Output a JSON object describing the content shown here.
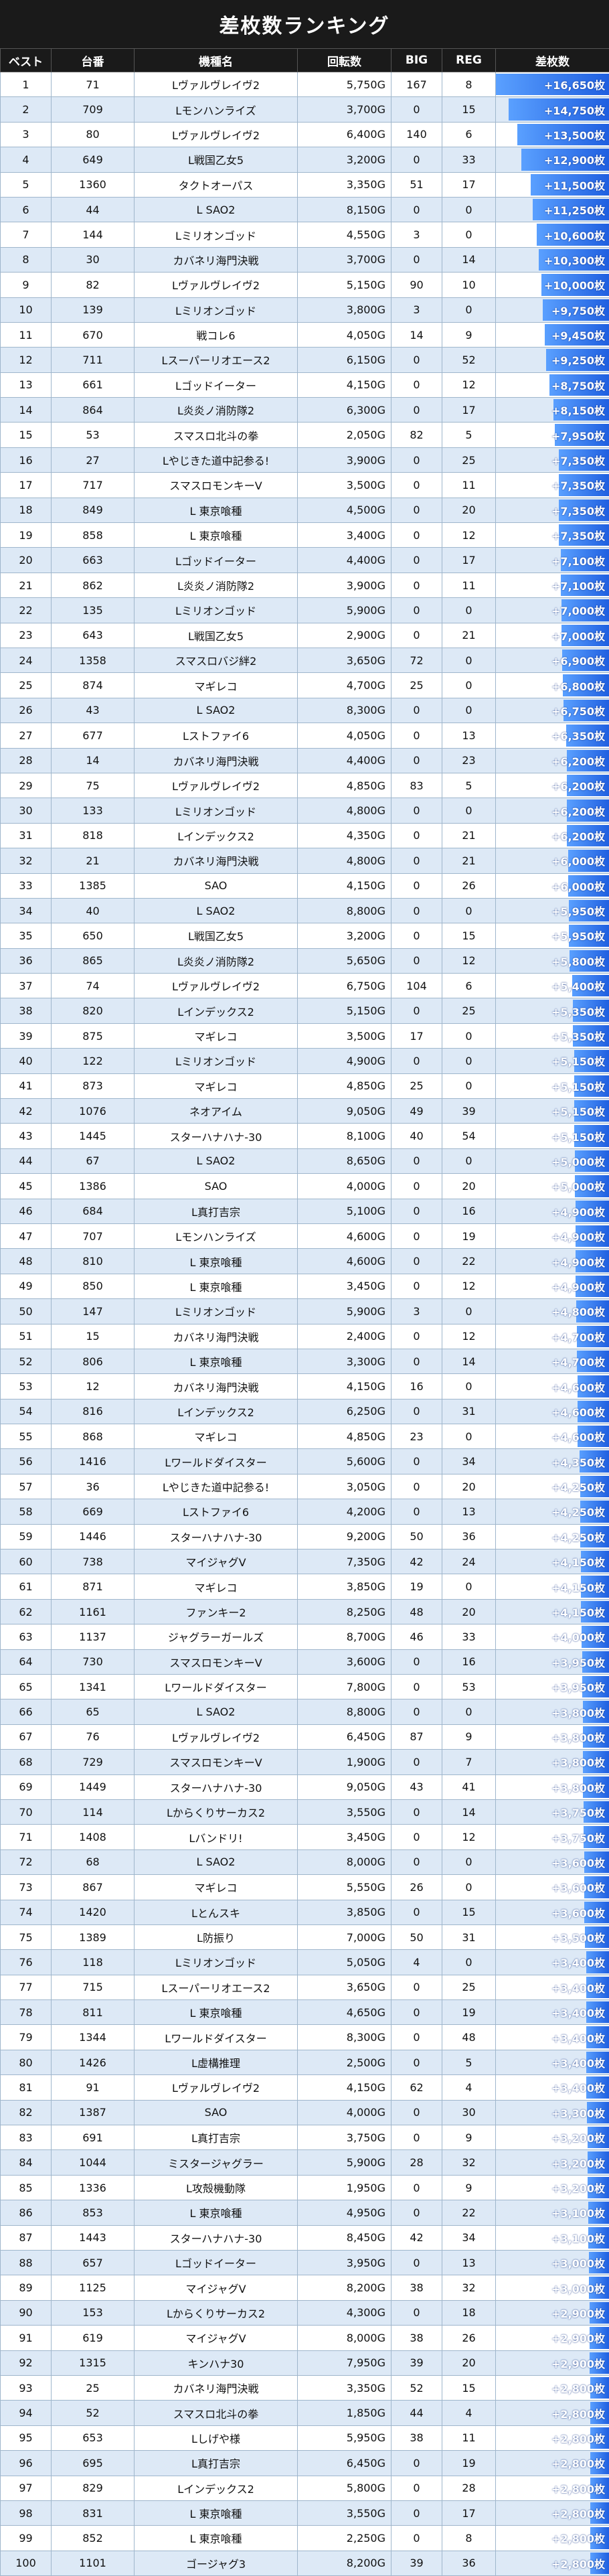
{
  "title": "差枚数ランキング",
  "headers": [
    "ベスト",
    "台番",
    "機種名",
    "回転数",
    "BIG",
    "REG",
    "差枚数"
  ],
  "unit": "枚",
  "colors": {
    "header_bg": "#1a1a1a",
    "row_alt": "#dde9f6",
    "bar": "#1f5fe0"
  },
  "rows": [
    [
      "1",
      "71",
      "Lヴァルヴレイヴ2",
      "5,750G",
      "167",
      "8",
      "+16,650枚"
    ],
    [
      "2",
      "709",
      "Lモンハンライズ",
      "3,700G",
      "0",
      "15",
      "+14,750枚"
    ],
    [
      "3",
      "80",
      "Lヴァルヴレイヴ2",
      "6,400G",
      "140",
      "6",
      "+13,500枚"
    ],
    [
      "4",
      "649",
      "L戦国乙女5",
      "3,200G",
      "0",
      "33",
      "+12,900枚"
    ],
    [
      "5",
      "1360",
      "タクトオーパス",
      "3,350G",
      "51",
      "17",
      "+11,500枚"
    ],
    [
      "6",
      "44",
      "L SAO2",
      "8,150G",
      "0",
      "0",
      "+11,250枚"
    ],
    [
      "7",
      "144",
      "Lミリオンゴッド",
      "4,550G",
      "3",
      "0",
      "+10,600枚"
    ],
    [
      "8",
      "30",
      "カバネリ海門決戦",
      "3,700G",
      "0",
      "14",
      "+10,300枚"
    ],
    [
      "9",
      "82",
      "Lヴァルヴレイヴ2",
      "5,150G",
      "90",
      "10",
      "+10,000枚"
    ],
    [
      "10",
      "139",
      "Lミリオンゴッド",
      "3,800G",
      "3",
      "0",
      "+9,750枚"
    ],
    [
      "11",
      "670",
      "戦コレ6",
      "4,050G",
      "14",
      "9",
      "+9,450枚"
    ],
    [
      "12",
      "711",
      "Lスーパーリオエース2",
      "6,150G",
      "0",
      "52",
      "+9,250枚"
    ],
    [
      "13",
      "661",
      "Lゴッドイーター",
      "4,150G",
      "0",
      "12",
      "+8,750枚"
    ],
    [
      "14",
      "864",
      "L炎炎ノ消防隊2",
      "6,300G",
      "0",
      "17",
      "+8,150枚"
    ],
    [
      "15",
      "53",
      "スマスロ北斗の拳",
      "2,050G",
      "82",
      "5",
      "+7,950枚"
    ],
    [
      "16",
      "27",
      "Lやじきた道中記参る!",
      "3,900G",
      "0",
      "25",
      "+7,350枚"
    ],
    [
      "17",
      "717",
      "スマスロモンキーV",
      "3,500G",
      "0",
      "11",
      "+7,350枚"
    ],
    [
      "18",
      "849",
      "L 東京喰種",
      "4,500G",
      "0",
      "20",
      "+7,350枚"
    ],
    [
      "19",
      "858",
      "L 東京喰種",
      "3,400G",
      "0",
      "12",
      "+7,350枚"
    ],
    [
      "20",
      "663",
      "Lゴッドイーター",
      "4,400G",
      "0",
      "17",
      "+7,100枚"
    ],
    [
      "21",
      "862",
      "L炎炎ノ消防隊2",
      "3,900G",
      "0",
      "11",
      "+7,100枚"
    ],
    [
      "22",
      "135",
      "Lミリオンゴッド",
      "5,900G",
      "0",
      "0",
      "+7,000枚"
    ],
    [
      "23",
      "643",
      "L戦国乙女5",
      "2,900G",
      "0",
      "21",
      "+7,000枚"
    ],
    [
      "24",
      "1358",
      "スマスロバジ絆2",
      "3,650G",
      "72",
      "0",
      "+6,900枚"
    ],
    [
      "25",
      "874",
      "マギレコ",
      "4,700G",
      "25",
      "0",
      "+6,800枚"
    ],
    [
      "26",
      "43",
      "L SAO2",
      "8,300G",
      "0",
      "0",
      "+6,750枚"
    ],
    [
      "27",
      "677",
      "Lストファイ6",
      "4,050G",
      "0",
      "13",
      "+6,350枚"
    ],
    [
      "28",
      "14",
      "カバネリ海門決戦",
      "4,400G",
      "0",
      "23",
      "+6,200枚"
    ],
    [
      "29",
      "75",
      "Lヴァルヴレイヴ2",
      "4,850G",
      "83",
      "5",
      "+6,200枚"
    ],
    [
      "30",
      "133",
      "Lミリオンゴッド",
      "4,800G",
      "0",
      "0",
      "+6,200枚"
    ],
    [
      "31",
      "818",
      "Lインデックス2",
      "4,350G",
      "0",
      "21",
      "+6,200枚"
    ],
    [
      "32",
      "21",
      "カバネリ海門決戦",
      "4,800G",
      "0",
      "21",
      "+6,000枚"
    ],
    [
      "33",
      "1385",
      "SAO",
      "4,150G",
      "0",
      "26",
      "+6,000枚"
    ],
    [
      "34",
      "40",
      "L SAO2",
      "8,800G",
      "0",
      "0",
      "+5,950枚"
    ],
    [
      "35",
      "650",
      "L戦国乙女5",
      "3,200G",
      "0",
      "15",
      "+5,950枚"
    ],
    [
      "36",
      "865",
      "L炎炎ノ消防隊2",
      "5,650G",
      "0",
      "12",
      "+5,800枚"
    ],
    [
      "37",
      "74",
      "Lヴァルヴレイヴ2",
      "6,750G",
      "104",
      "6",
      "+5,400枚"
    ],
    [
      "38",
      "820",
      "Lインデックス2",
      "5,150G",
      "0",
      "25",
      "+5,350枚"
    ],
    [
      "39",
      "875",
      "マギレコ",
      "3,500G",
      "17",
      "0",
      "+5,350枚"
    ],
    [
      "40",
      "122",
      "Lミリオンゴッド",
      "4,900G",
      "0",
      "0",
      "+5,150枚"
    ],
    [
      "41",
      "873",
      "マギレコ",
      "4,850G",
      "25",
      "0",
      "+5,150枚"
    ],
    [
      "42",
      "1076",
      "ネオアイム",
      "9,050G",
      "49",
      "39",
      "+5,150枚"
    ],
    [
      "43",
      "1445",
      "スターハナハナ-30",
      "8,100G",
      "40",
      "54",
      "+5,150枚"
    ],
    [
      "44",
      "67",
      "L SAO2",
      "8,650G",
      "0",
      "0",
      "+5,000枚"
    ],
    [
      "45",
      "1386",
      "SAO",
      "4,000G",
      "0",
      "20",
      "+5,000枚"
    ],
    [
      "46",
      "684",
      "L真打吉宗",
      "5,100G",
      "0",
      "16",
      "+4,900枚"
    ],
    [
      "47",
      "707",
      "Lモンハンライズ",
      "4,600G",
      "0",
      "19",
      "+4,900枚"
    ],
    [
      "48",
      "810",
      "L 東京喰種",
      "4,600G",
      "0",
      "22",
      "+4,900枚"
    ],
    [
      "49",
      "850",
      "L 東京喰種",
      "3,450G",
      "0",
      "12",
      "+4,900枚"
    ],
    [
      "50",
      "147",
      "Lミリオンゴッド",
      "5,900G",
      "3",
      "0",
      "+4,800枚"
    ],
    [
      "51",
      "15",
      "カバネリ海門決戦",
      "2,400G",
      "0",
      "12",
      "+4,700枚"
    ],
    [
      "52",
      "806",
      "L 東京喰種",
      "3,300G",
      "0",
      "14",
      "+4,700枚"
    ],
    [
      "53",
      "12",
      "カバネリ海門決戦",
      "4,150G",
      "16",
      "0",
      "+4,600枚"
    ],
    [
      "54",
      "816",
      "Lインデックス2",
      "6,250G",
      "0",
      "31",
      "+4,600枚"
    ],
    [
      "55",
      "868",
      "マギレコ",
      "4,850G",
      "23",
      "0",
      "+4,600枚"
    ],
    [
      "56",
      "1416",
      "Lワールドダイスター",
      "5,600G",
      "0",
      "34",
      "+4,350枚"
    ],
    [
      "57",
      "36",
      "Lやじきた道中記参る!",
      "3,050G",
      "0",
      "20",
      "+4,250枚"
    ],
    [
      "58",
      "669",
      "Lストファイ6",
      "4,200G",
      "0",
      "13",
      "+4,250枚"
    ],
    [
      "59",
      "1446",
      "スターハナハナ-30",
      "9,200G",
      "50",
      "36",
      "+4,250枚"
    ],
    [
      "60",
      "738",
      "マイジャグV",
      "7,350G",
      "42",
      "24",
      "+4,150枚"
    ],
    [
      "61",
      "871",
      "マギレコ",
      "3,850G",
      "19",
      "0",
      "+4,150枚"
    ],
    [
      "62",
      "1161",
      "ファンキー2",
      "8,250G",
      "48",
      "20",
      "+4,150枚"
    ],
    [
      "63",
      "1137",
      "ジャグラーガールズ",
      "8,700G",
      "46",
      "33",
      "+4,000枚"
    ],
    [
      "64",
      "730",
      "スマスロモンキーV",
      "3,600G",
      "0",
      "16",
      "+3,950枚"
    ],
    [
      "65",
      "1341",
      "Lワールドダイスター",
      "7,800G",
      "0",
      "53",
      "+3,950枚"
    ],
    [
      "66",
      "65",
      "L SAO2",
      "8,800G",
      "0",
      "0",
      "+3,800枚"
    ],
    [
      "67",
      "76",
      "Lヴァルヴレイヴ2",
      "6,450G",
      "87",
      "9",
      "+3,800枚"
    ],
    [
      "68",
      "729",
      "スマスロモンキーV",
      "1,900G",
      "0",
      "7",
      "+3,800枚"
    ],
    [
      "69",
      "1449",
      "スターハナハナ-30",
      "9,050G",
      "43",
      "41",
      "+3,800枚"
    ],
    [
      "70",
      "114",
      "Lからくりサーカス2",
      "3,550G",
      "0",
      "14",
      "+3,750枚"
    ],
    [
      "71",
      "1408",
      "Lバンドリ!",
      "3,450G",
      "0",
      "12",
      "+3,750枚"
    ],
    [
      "72",
      "68",
      "L SAO2",
      "8,000G",
      "0",
      "0",
      "+3,600枚"
    ],
    [
      "73",
      "867",
      "マギレコ",
      "5,550G",
      "26",
      "0",
      "+3,600枚"
    ],
    [
      "74",
      "1420",
      "Lとんスキ",
      "3,850G",
      "0",
      "15",
      "+3,600枚"
    ],
    [
      "75",
      "1389",
      "L防振り",
      "7,000G",
      "50",
      "31",
      "+3,500枚"
    ],
    [
      "76",
      "118",
      "Lミリオンゴッド",
      "5,050G",
      "4",
      "0",
      "+3,400枚"
    ],
    [
      "77",
      "715",
      "Lスーパーリオエース2",
      "3,650G",
      "0",
      "25",
      "+3,400枚"
    ],
    [
      "78",
      "811",
      "L 東京喰種",
      "4,650G",
      "0",
      "19",
      "+3,400枚"
    ],
    [
      "79",
      "1344",
      "Lワールドダイスター",
      "8,300G",
      "0",
      "48",
      "+3,400枚"
    ],
    [
      "80",
      "1426",
      "L虚構推理",
      "2,500G",
      "0",
      "5",
      "+3,400枚"
    ],
    [
      "81",
      "91",
      "Lヴァルヴレイヴ2",
      "4,150G",
      "62",
      "4",
      "+3,400枚"
    ],
    [
      "82",
      "1387",
      "SAO",
      "4,000G",
      "0",
      "30",
      "+3,300枚"
    ],
    [
      "83",
      "691",
      "L真打吉宗",
      "3,750G",
      "0",
      "9",
      "+3,200枚"
    ],
    [
      "84",
      "1044",
      "ミスタージャグラー",
      "5,900G",
      "28",
      "32",
      "+3,200枚"
    ],
    [
      "85",
      "1336",
      "L攻殻機動隊",
      "1,950G",
      "0",
      "9",
      "+3,200枚"
    ],
    [
      "86",
      "853",
      "L 東京喰種",
      "4,950G",
      "0",
      "22",
      "+3,100枚"
    ],
    [
      "87",
      "1443",
      "スターハナハナ-30",
      "8,450G",
      "42",
      "34",
      "+3,100枚"
    ],
    [
      "88",
      "657",
      "Lゴッドイーター",
      "3,950G",
      "0",
      "13",
      "+3,000枚"
    ],
    [
      "89",
      "1125",
      "マイジャグV",
      "8,200G",
      "38",
      "32",
      "+3,000枚"
    ],
    [
      "90",
      "153",
      "Lからくりサーカス2",
      "4,300G",
      "0",
      "18",
      "+2,900枚"
    ],
    [
      "91",
      "619",
      "マイジャグV",
      "8,000G",
      "38",
      "26",
      "+2,900枚"
    ],
    [
      "92",
      "1315",
      "キンハナ30",
      "7,950G",
      "39",
      "20",
      "+2,900枚"
    ],
    [
      "93",
      "25",
      "カバネリ海門決戦",
      "3,350G",
      "52",
      "15",
      "+2,800枚"
    ],
    [
      "94",
      "52",
      "スマスロ北斗の拳",
      "1,850G",
      "44",
      "4",
      "+2,800枚"
    ],
    [
      "95",
      "653",
      "Lしげや様",
      "5,950G",
      "38",
      "11",
      "+2,800枚"
    ],
    [
      "96",
      "695",
      "L真打吉宗",
      "6,450G",
      "0",
      "19",
      "+2,800枚"
    ],
    [
      "97",
      "829",
      "Lインデックス2",
      "5,800G",
      "0",
      "28",
      "+2,800枚"
    ],
    [
      "98",
      "831",
      "L 東京喰種",
      "3,550G",
      "0",
      "17",
      "+2,800枚"
    ],
    [
      "99",
      "852",
      "L 東京喰種",
      "2,250G",
      "0",
      "8",
      "+2,800枚"
    ],
    [
      "100",
      "1101",
      "ゴージャグ3",
      "8,200G",
      "39",
      "36",
      "+2,800枚"
    ]
  ]
}
